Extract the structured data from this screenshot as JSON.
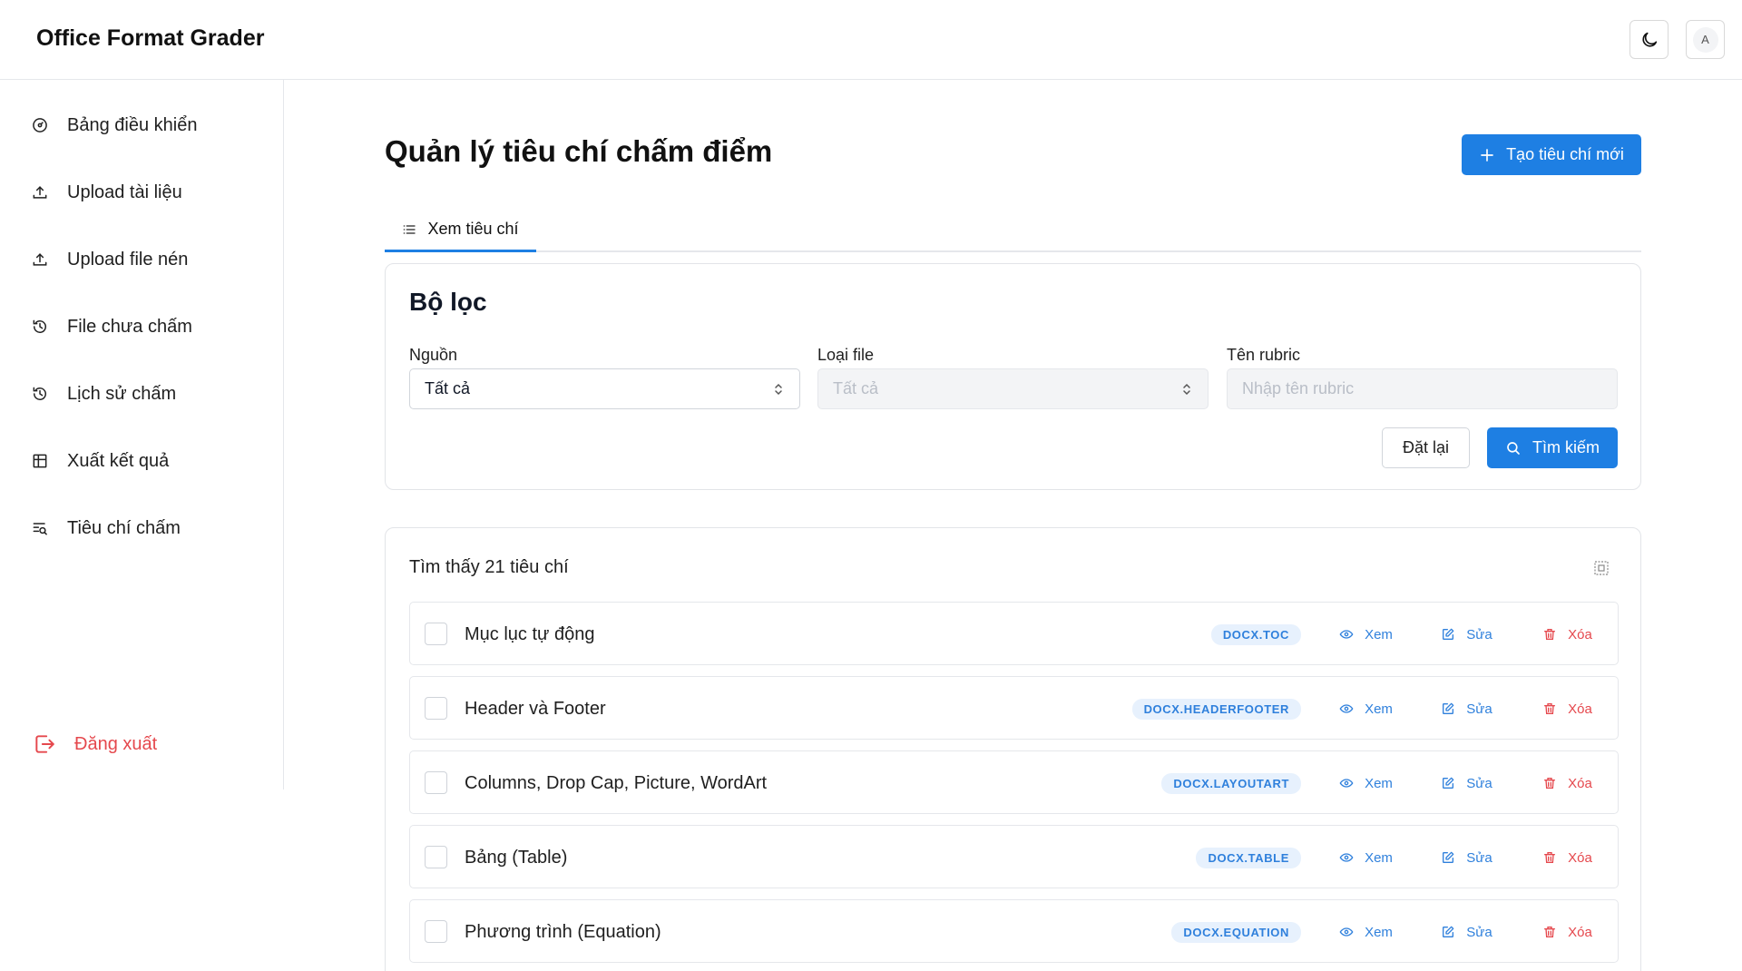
{
  "header": {
    "brand": "Office Format Grader",
    "avatar_initial": "A"
  },
  "sidebar": {
    "items": [
      {
        "label": "Bảng điều khiển",
        "icon": "dashboard-icon"
      },
      {
        "label": "Upload tài liệu",
        "icon": "upload-icon"
      },
      {
        "label": "Upload file nén",
        "icon": "upload-icon"
      },
      {
        "label": "File chưa chấm",
        "icon": "history-icon"
      },
      {
        "label": "Lịch sử chấm",
        "icon": "history-icon"
      },
      {
        "label": "Xuất kết quả",
        "icon": "table-icon"
      },
      {
        "label": "Tiêu chí chấm",
        "icon": "list-search-icon"
      }
    ],
    "logout": "Đăng xuất"
  },
  "page": {
    "title": "Quản lý tiêu chí chấm điểm",
    "create_button": "Tạo tiêu chí mới",
    "tab_view": "Xem tiêu chí"
  },
  "filter": {
    "heading": "Bộ lọc",
    "source_label": "Nguồn",
    "source_value": "Tất cả",
    "filetype_label": "Loại file",
    "filetype_value": "Tất cả",
    "rubric_label": "Tên rubric",
    "rubric_placeholder": "Nhập tên rubric",
    "reset_button": "Đặt lại",
    "search_button": "Tìm kiếm"
  },
  "results": {
    "count_text": "Tìm thấy 21 tiêu chí",
    "view_label": "Xem",
    "edit_label": "Sửa",
    "delete_label": "Xóa",
    "rows": [
      {
        "name": "Mục lục tự động",
        "tag": "DOCX.TOC"
      },
      {
        "name": "Header và Footer",
        "tag": "DOCX.HEADERFOOTER"
      },
      {
        "name": "Columns, Drop Cap, Picture, WordArt",
        "tag": "DOCX.LAYOUTART"
      },
      {
        "name": "Bảng (Table)",
        "tag": "DOCX.TABLE"
      },
      {
        "name": "Phương trình (Equation)",
        "tag": "DOCX.EQUATION"
      }
    ]
  },
  "colors": {
    "primary": "#1e7fe3",
    "danger": "#e5484d",
    "tag_bg": "#e7f1fd"
  }
}
